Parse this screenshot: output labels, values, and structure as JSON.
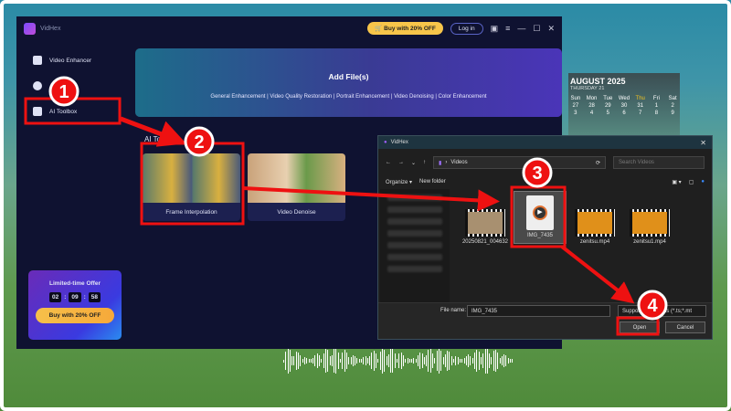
{
  "app": {
    "title": "VidHex",
    "buy_label": "Buy with 20% OFF",
    "login_label": "Log in"
  },
  "sidebar": {
    "items": [
      {
        "label": "Video Enhancer"
      },
      {
        "label": "AI"
      },
      {
        "label": "AI Toolbox"
      }
    ]
  },
  "offer": {
    "title": "Limited-time Offer",
    "hours": "02",
    "minutes": "09",
    "seconds": "58",
    "button": "Buy with 20% OFF"
  },
  "banner": {
    "title": "Add File(s)",
    "subtitle": "General Enhancement | Video Quality Restoration | Portrait Enhancement | Video Denoising | Color Enhancement"
  },
  "toolbox": {
    "title": "AI Toolbox",
    "cards": [
      {
        "label": "Frame Interpolation"
      },
      {
        "label": "Video Denoise"
      }
    ]
  },
  "dialog": {
    "title": "VidHex",
    "path": "Videos",
    "search_placeholder": "Search Videos",
    "organize": "Organize",
    "new_folder": "New folder",
    "files": [
      {
        "name": "20250821_004632"
      },
      {
        "name": "IMG_7435"
      },
      {
        "name": "zenitsu.mp4"
      },
      {
        "name": "zenitsu1.mp4"
      }
    ],
    "file_name_label": "File name:",
    "file_name": "IMG_7435",
    "file_type": "Supported Formats (*.ts;*.mt",
    "open": "Open",
    "cancel": "Cancel"
  },
  "calendar": {
    "month": "AUGUST 2025",
    "day": "THURSDAY 21",
    "weekdays": [
      "Sun",
      "Mon",
      "Tue",
      "Wed",
      "Thu",
      "Fri",
      "Sat"
    ],
    "row1": [
      "27",
      "28",
      "29",
      "30",
      "31",
      "1",
      "2"
    ],
    "row2": [
      "3",
      "4",
      "5",
      "6",
      "7",
      "8",
      "9"
    ]
  },
  "annotations": {
    "steps": [
      "1",
      "2",
      "3",
      "4"
    ],
    "color": "#ee1111"
  }
}
